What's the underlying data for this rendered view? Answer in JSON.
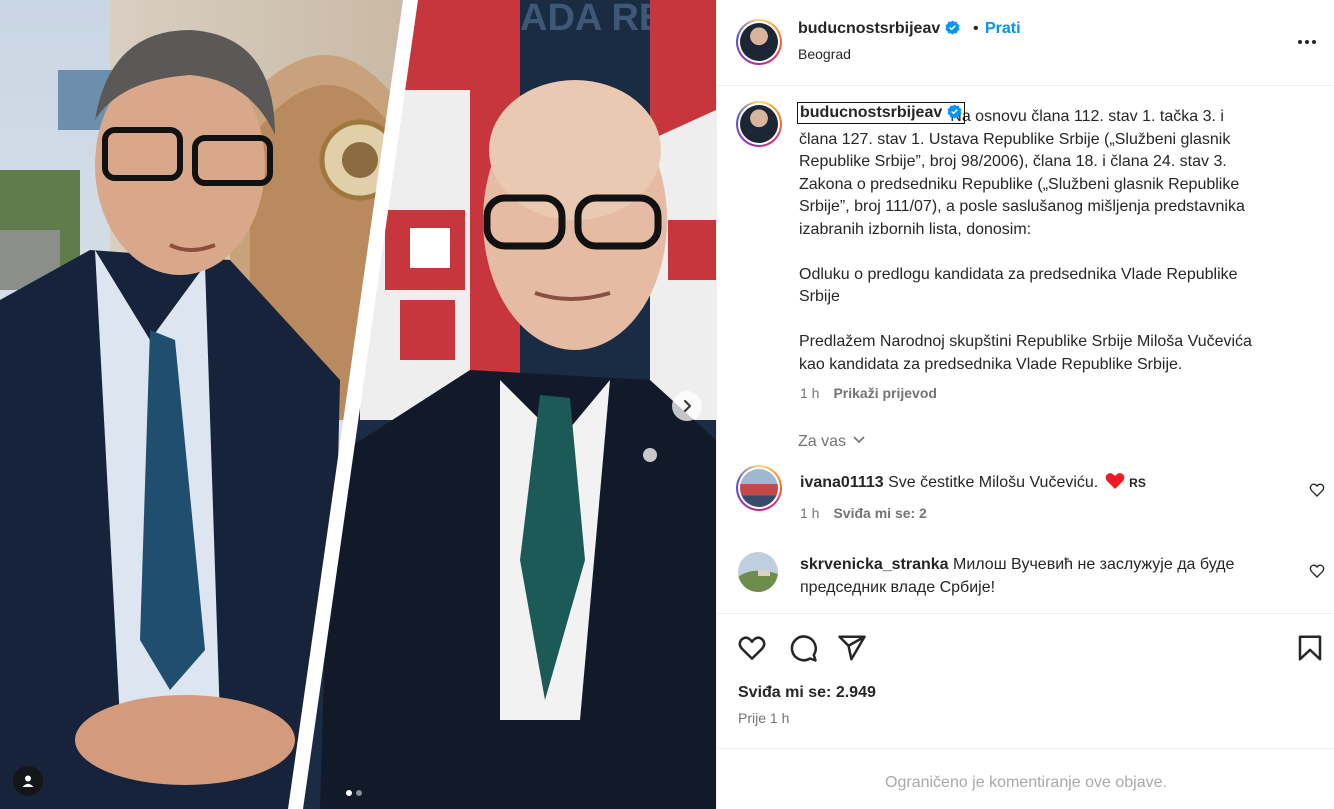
{
  "header": {
    "username": "buducnostsrbijeav",
    "separator": "•",
    "follow_label": "Prati",
    "location": "Beograd"
  },
  "caption": {
    "username": "buducnostsrbijeav",
    "text": "Na osnovu člana 112. stav 1. tačka 3. i\nčlana 127. stav 1. Ustava Republike Srbije („Službeni glasnik\nRepublike Srbije”, broj 98/2006), člana 18. i člana 24. stav 3.\nZakona o predsedniku Republike („Službeni glasnik Republike\nSrbije”, broj 111/07), a posle saslušanog mišljenja predstavnika\nizabranih izbornih lista, donosim:\n\nOdluku o predlogu kandidata za predsednika Vlade Republike\nSrbije\n\nPredlažem Narodnoj skupštini Republike Srbije Miloša Vučevića\nkao kandidata za predsednika Vlade Republike Srbije.",
    "time": "1 h",
    "translate_label": "Prikaži prijevod"
  },
  "for_you_label": "Za vas",
  "comments": [
    {
      "username": "ivana01113",
      "text": "Sve čestitke Milošu Vučeviću.",
      "flag_text": "RS",
      "time": "1 h",
      "likes_label": "Sviđa mi se: 2"
    },
    {
      "username": "skrvenicka_stranka",
      "text": "Милош Вучевић не заслужује да буде председник владе Србије!"
    }
  ],
  "likes_label": "Sviđa mi se: 2.949",
  "post_time": "Prije 1 h",
  "comments_disabled": "Ograničeno je komentiranje ove objave.",
  "background_text": "ADA REPI",
  "carousel": {
    "current": 1,
    "total": 2
  },
  "icons": {
    "verified": "verified-badge-icon",
    "more": "more-options-icon",
    "like": "heart-icon",
    "comment": "comment-icon",
    "share": "share-icon",
    "save": "bookmark-icon",
    "next": "chevron-right-icon",
    "tags": "person-tag-icon",
    "for_you": "chevron-down-icon"
  },
  "colors": {
    "accent": "#0095f6",
    "verified": "#0095f6",
    "heart_red": "#ed1c24",
    "muted": "#737373"
  }
}
